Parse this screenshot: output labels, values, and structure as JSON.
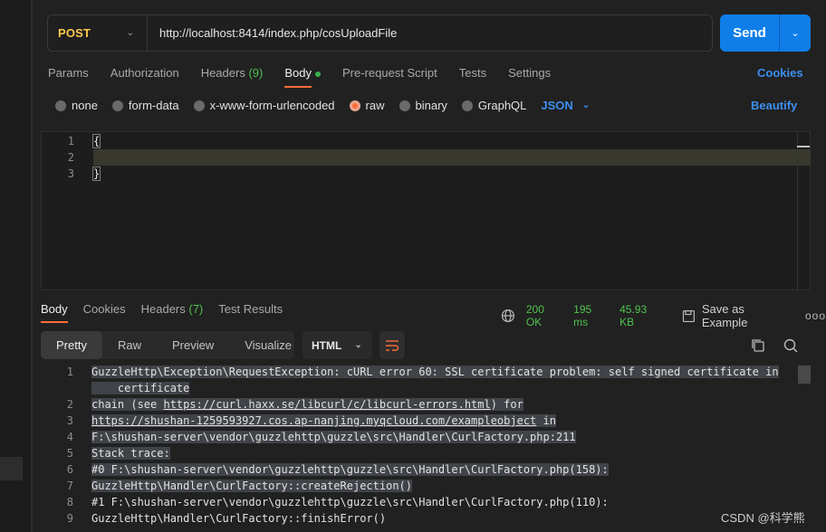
{
  "request": {
    "method": "POST",
    "url": "http://localhost:8414/index.php/cosUploadFile",
    "send_label": "Send"
  },
  "request_tabs": [
    {
      "label": "Params"
    },
    {
      "label": "Authorization"
    },
    {
      "label": "Headers",
      "count": "(9)"
    },
    {
      "label": "Body"
    },
    {
      "label": "Pre-request Script"
    },
    {
      "label": "Tests"
    },
    {
      "label": "Settings"
    }
  ],
  "cookies_label": "Cookies",
  "body_types": {
    "none": "none",
    "form_data": "form-data",
    "urlencoded": "x-www-form-urlencoded",
    "raw": "raw",
    "binary": "binary",
    "graphql": "GraphQL",
    "selected": "raw",
    "format": "JSON"
  },
  "beautify_label": "Beautify",
  "editor": {
    "line_numbers": [
      "1",
      "2",
      "3"
    ],
    "lines": [
      "{",
      "",
      "}"
    ]
  },
  "response_tabs": [
    {
      "label": "Body"
    },
    {
      "label": "Cookies"
    },
    {
      "label": "Headers",
      "count": "(7)"
    },
    {
      "label": "Test Results"
    }
  ],
  "response_meta": {
    "status": "200 OK",
    "time": "195 ms",
    "size": "45.93 KB",
    "save_label": "Save as Example",
    "more": "ooo"
  },
  "format_tabs": [
    "Pretty",
    "Raw",
    "Preview",
    "Visualize"
  ],
  "language": "HTML",
  "response_lines": [
    {
      "n": "1",
      "text": "GuzzleHttp\\Exception\\RequestException: cURL error 60: SSL certificate problem: self signed certificate in"
    },
    {
      "n": "",
      "text": "    certificate"
    },
    {
      "n": "2",
      "pre": "chain (see ",
      "link": "https://curl.haxx.se/libcurl/c/libcurl-errors.html",
      "post": ") for"
    },
    {
      "n": "3",
      "pre": "",
      "link": "https://shushan-1259593927.cos.ap-nanjing.myqcloud.com/exampleobject",
      "post": " in"
    },
    {
      "n": "4",
      "text": "F:\\shushan-server\\vendor\\guzzlehttp\\guzzle\\src\\Handler\\CurlFactory.php:211"
    },
    {
      "n": "5",
      "text": "Stack trace:"
    },
    {
      "n": "6",
      "text": "#0 F:\\shushan-server\\vendor\\guzzlehttp\\guzzle\\src\\Handler\\CurlFactory.php(158):"
    },
    {
      "n": "7",
      "text": "GuzzleHttp\\Handler\\CurlFactory::createRejection()"
    },
    {
      "n": "8",
      "text": "#1 F:\\shushan-server\\vendor\\guzzlehttp\\guzzle\\src\\Handler\\CurlFactory.php(110):"
    },
    {
      "n": "9",
      "text": "GuzzleHttp\\Handler\\CurlFactory::finishError()"
    }
  ],
  "watermark": "CSDN @科学熊"
}
